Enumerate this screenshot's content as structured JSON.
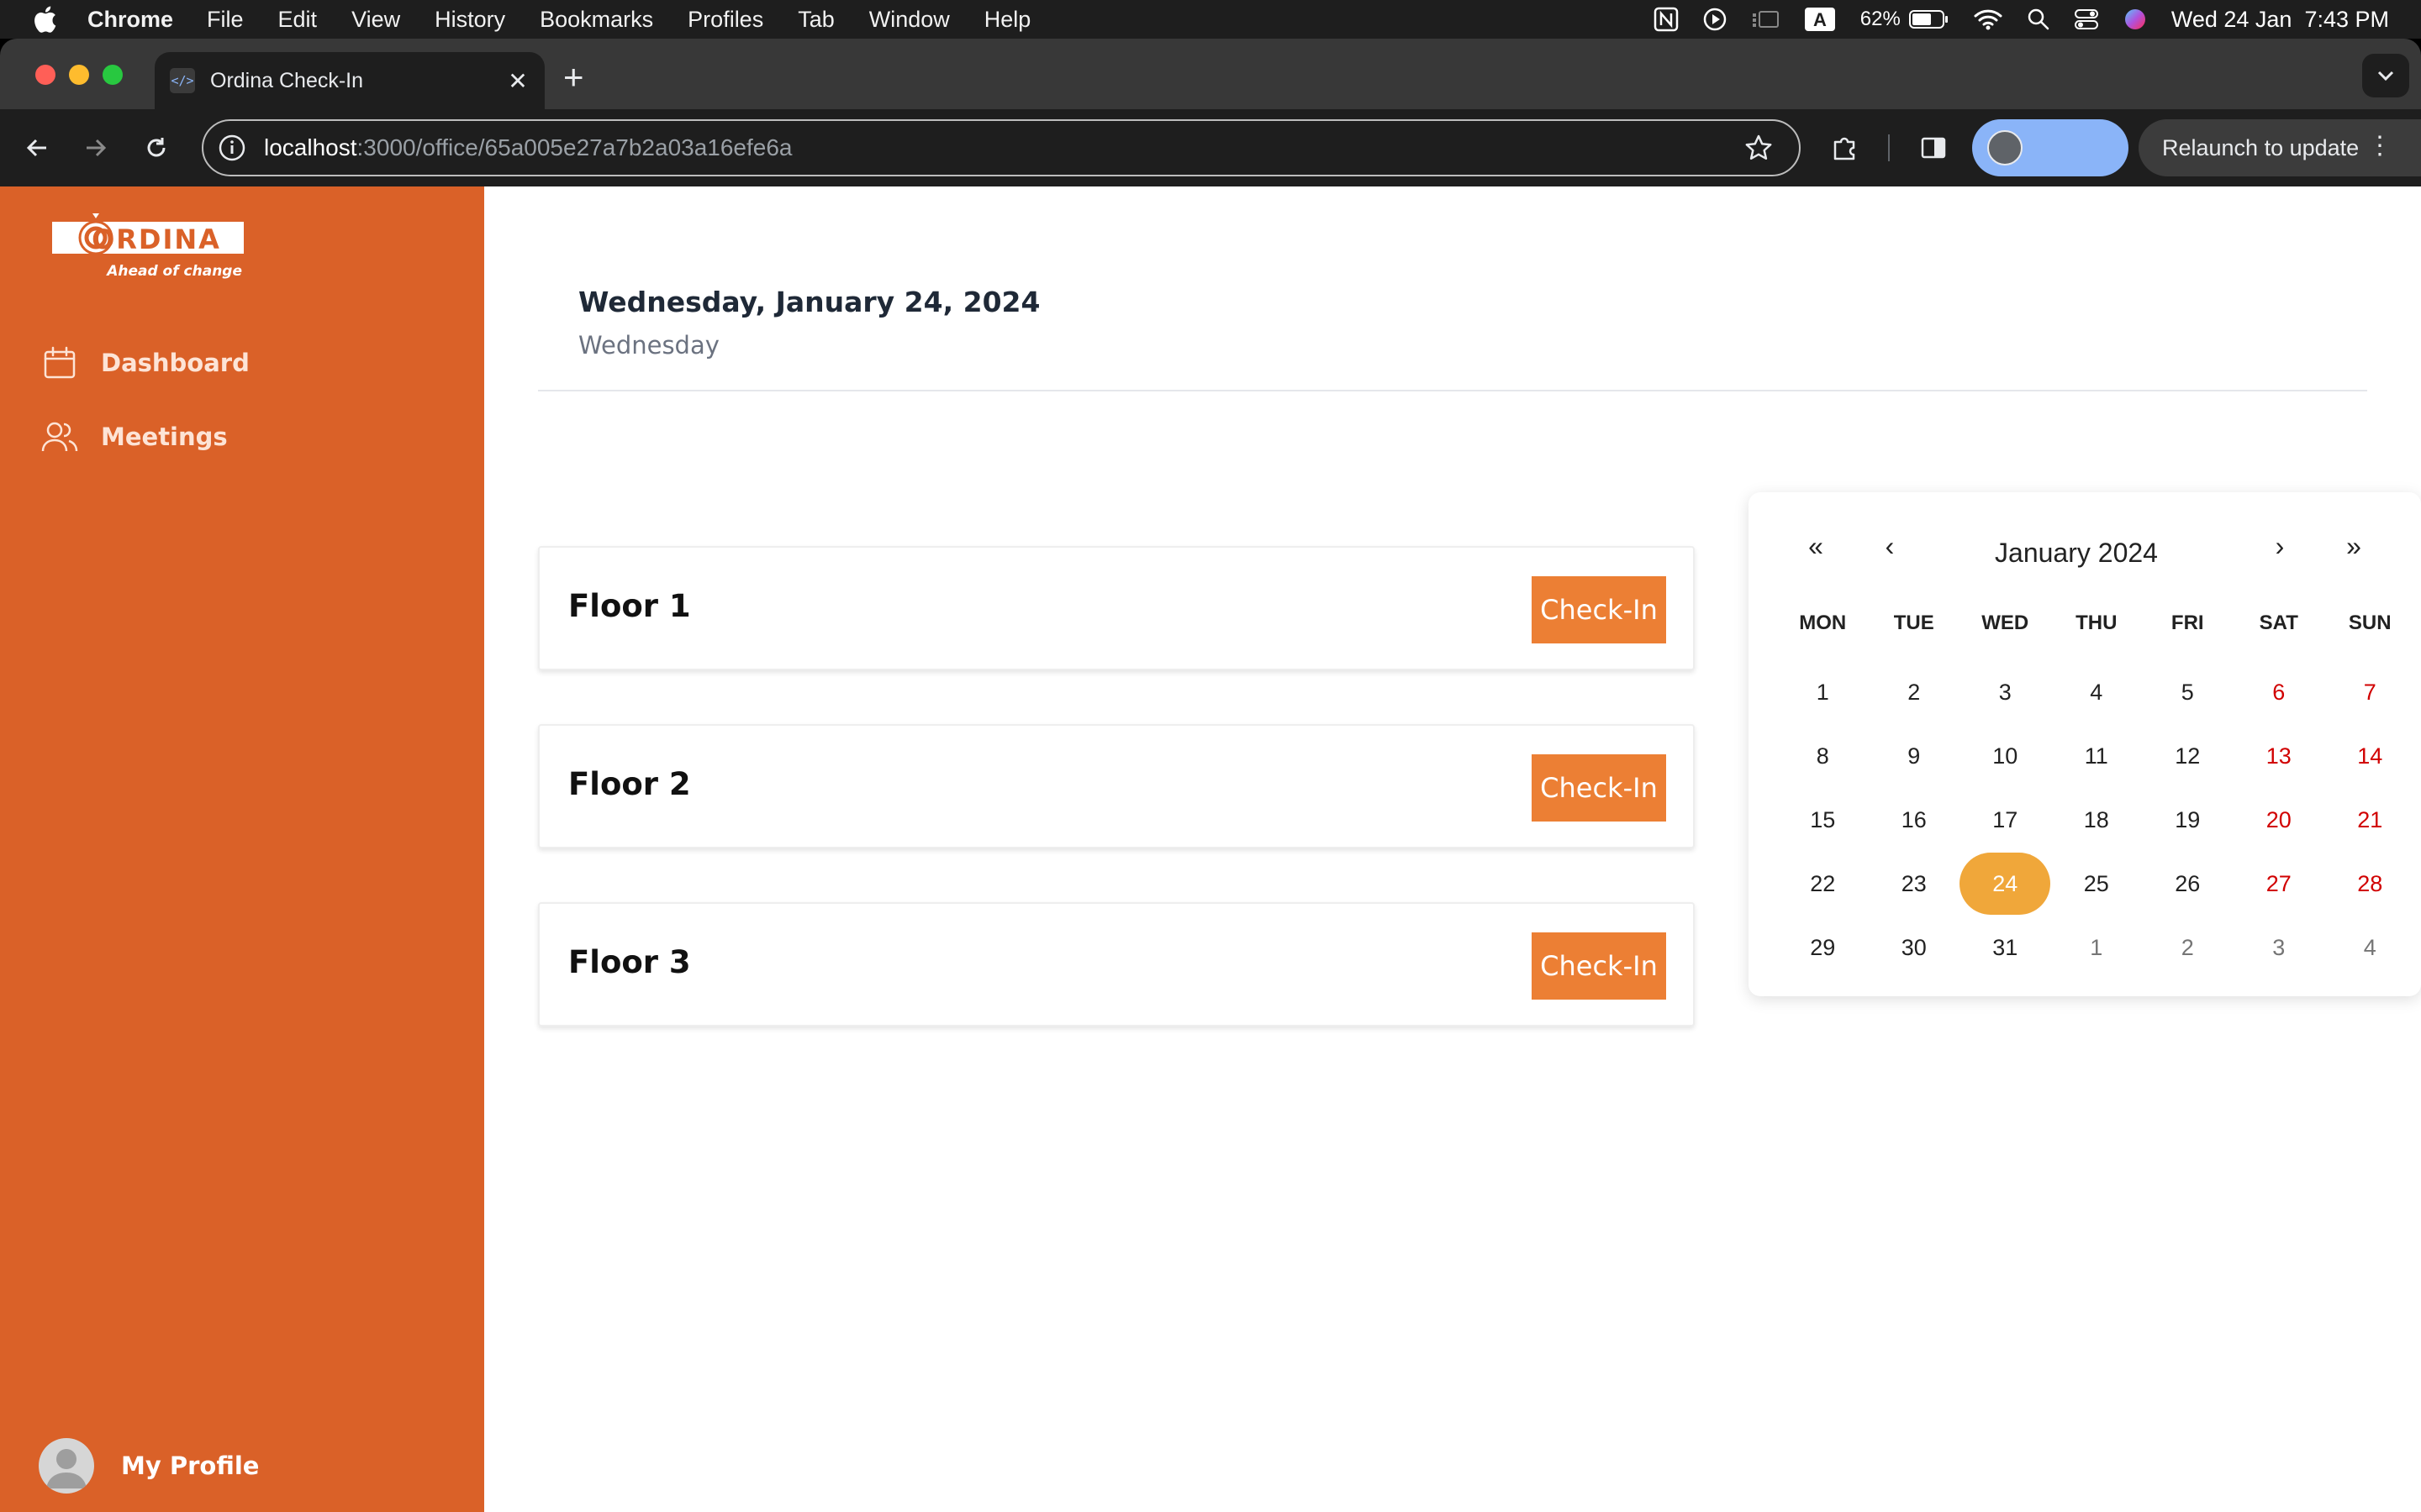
{
  "menubar": {
    "app_name": "Chrome",
    "items": [
      "File",
      "Edit",
      "View",
      "History",
      "Bookmarks",
      "Profiles",
      "Tab",
      "Window",
      "Help"
    ],
    "battery": "62%",
    "datetime": "Wed 24 Jan  7:43 PM",
    "keyboard_input": "A"
  },
  "browser": {
    "tab_title": "Ordina Check-In",
    "favicon_text": "</>",
    "url_host": "localhost",
    "url_rest": ":3000/office/65a005e27a7b2a03a16efe6a",
    "relaunch_label": "Relaunch to update"
  },
  "sidebar": {
    "logo_text": "ORDINA",
    "logo_tagline": "Ahead of change",
    "items": [
      {
        "label": "Dashboard",
        "icon": "calendar-icon"
      },
      {
        "label": "Meetings",
        "icon": "users-icon"
      }
    ],
    "profile_label": "My Profile"
  },
  "header": {
    "date_full": "Wednesday, January 24, 2024",
    "weekday": "Wednesday"
  },
  "floors": [
    {
      "name": "Floor 1",
      "button": "Check-In"
    },
    {
      "name": "Floor 2",
      "button": "Check-In"
    },
    {
      "name": "Floor 3",
      "button": "Check-In"
    }
  ],
  "calendar": {
    "title": "January 2024",
    "prev_year": "«",
    "prev_month": "‹",
    "next_month": "›",
    "next_year": "»",
    "weekdays": [
      "MON",
      "TUE",
      "WED",
      "THU",
      "FRI",
      "SAT",
      "SUN"
    ],
    "selected_day": "24",
    "colors": {
      "selected": "#f0a73a",
      "weekend": "#d10000",
      "accent": "#da6128",
      "button": "#ec7f34"
    },
    "weeks": [
      [
        "1",
        "2",
        "3",
        "4",
        "5",
        "6",
        "7"
      ],
      [
        "8",
        "9",
        "10",
        "11",
        "12",
        "13",
        "14"
      ],
      [
        "15",
        "16",
        "17",
        "18",
        "19",
        "20",
        "21"
      ],
      [
        "22",
        "23",
        "24",
        "25",
        "26",
        "27",
        "28"
      ],
      [
        "29",
        "30",
        "31",
        "1",
        "2",
        "3",
        "4"
      ]
    ]
  }
}
